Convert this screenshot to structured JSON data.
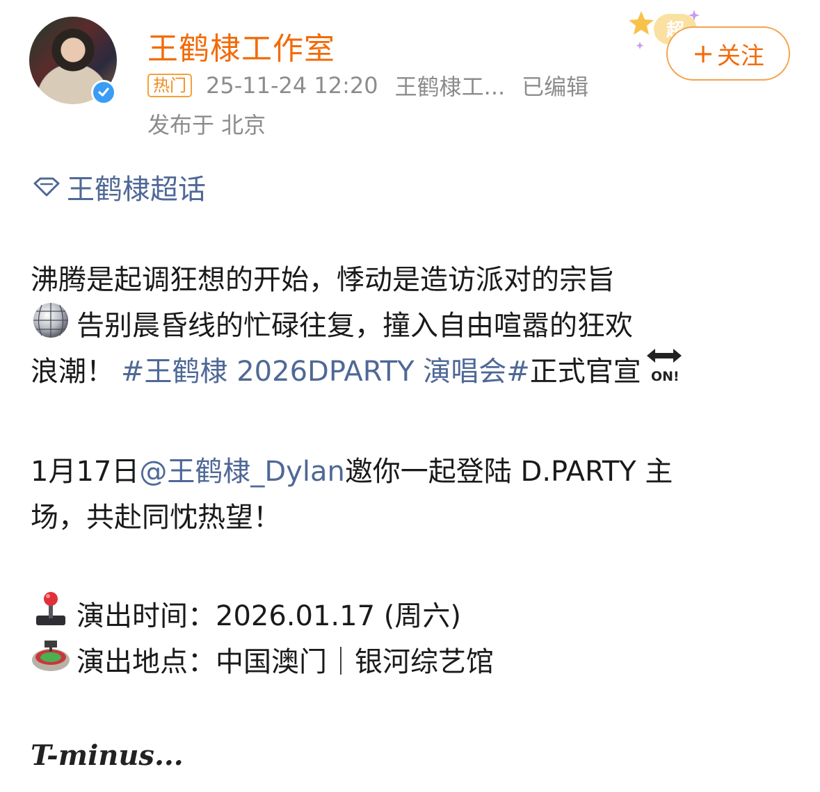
{
  "post": {
    "author": "王鹤棣工作室",
    "hot_badge": "热门",
    "timestamp": "25-11-24 12:20",
    "source": "王鹤棣工...",
    "edited": "已编辑",
    "location": "发布于 北京",
    "follow_plus": "+",
    "follow_label": "关注",
    "super_badge_text": "超"
  },
  "content": {
    "topic": "王鹤棣超话",
    "p1_line1": "沸腾是起调狂想的开始，悸动是造访派对的宗旨",
    "p1_line2": "告别晨昏线的忙碌往复，撞入自由喧嚣的狂欢",
    "p1_line3_a": "浪潮！",
    "hashtag": "#王鹤棣 2026DPARTY 演唱会#",
    "p1_line3_b": " 正式官宣",
    "on_emoji_text": "ON!",
    "p2_a": "1月17日 ",
    "mention": "@王鹤棣_Dylan",
    "p2_b": " 邀你一起登陆 D.PARTY 主",
    "p2_line2": "场，共赴同忱热望！",
    "time_label": "演出时间：2026.01.17 (周六)",
    "venue_label": "演出地点：中国澳门｜银河综艺馆",
    "tminus": "T-minus..."
  },
  "icons": {
    "verified": "verified-badge-icon",
    "topic": "super-topic-diamond-icon",
    "disco": "mirror-ball-icon",
    "on": "on-arrow-icon",
    "joystick": "joystick-icon",
    "stadium": "stadium-icon"
  },
  "colors": {
    "author": "#f26b0a",
    "link": "#4f6896",
    "meta": "#8c8c8c",
    "follow_border": "#f6a14d",
    "verified": "#3a9cf5"
  }
}
